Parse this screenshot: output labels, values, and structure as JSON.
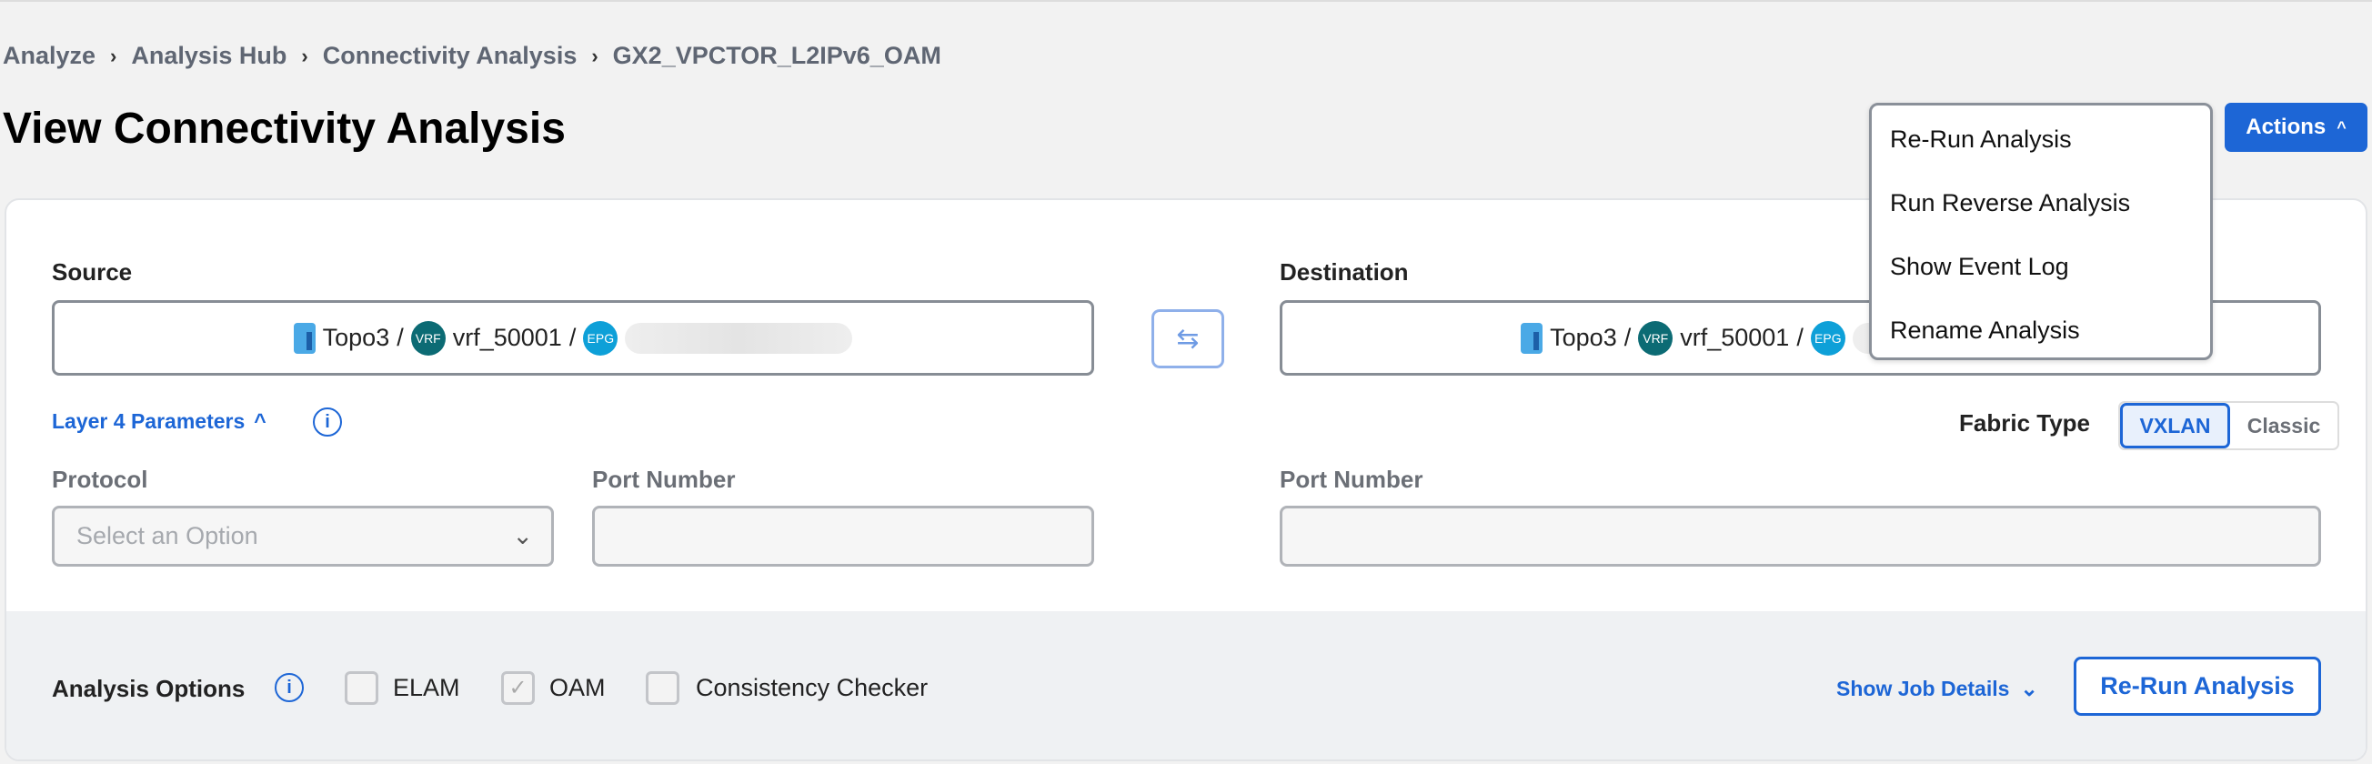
{
  "breadcrumb": [
    "Analyze",
    "Analysis Hub",
    "Connectivity Analysis",
    "GX2_VPCTOR_L2IPv6_OAM"
  ],
  "breadcrumb_separator": "›",
  "page_title": "View Connectivity Analysis",
  "actions": {
    "label": "Actions",
    "icon": "chevron-up-icon",
    "menu": [
      "Re-Run Analysis",
      "Run Reverse Analysis",
      "Show Event Log",
      "Rename Analysis"
    ]
  },
  "source": {
    "label": "Source",
    "topology": "Topo3",
    "sep": "/",
    "vrf_badge": "VRF",
    "vrf": "vrf_50001",
    "epg_badge": "EPG"
  },
  "destination": {
    "label": "Destination",
    "topology": "Topo3",
    "sep": "/",
    "vrf_badge": "VRF",
    "vrf": "vrf_50001",
    "epg_badge": "EPG"
  },
  "layer4": {
    "label": "Layer 4 Parameters",
    "protocol_label": "Protocol",
    "protocol_placeholder": "Select an Option",
    "src_port_label": "Port Number",
    "dst_port_label": "Port Number"
  },
  "fabric": {
    "label": "Fabric Type",
    "options": [
      "VXLAN",
      "Classic"
    ],
    "selected": "VXLAN"
  },
  "analysis_options": {
    "label": "Analysis Options",
    "items": [
      {
        "label": "ELAM",
        "checked": false
      },
      {
        "label": "OAM",
        "checked": true
      },
      {
        "label": "Consistency Checker",
        "checked": false
      }
    ]
  },
  "show_job_details": "Show Job Details",
  "rerun_button": "Re-Run Analysis",
  "colors": {
    "accent": "#1d66d6",
    "vrf": "#0c6b74",
    "epg": "#0ea0d8"
  }
}
